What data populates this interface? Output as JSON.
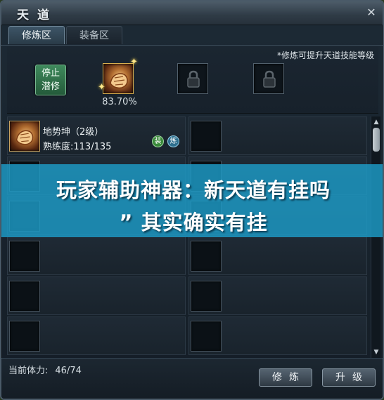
{
  "window": {
    "title": "天道",
    "close_symbol": "✕"
  },
  "tabs": [
    {
      "label": "修炼区",
      "active": true
    },
    {
      "label": "装备区",
      "active": false
    }
  ],
  "top_panel": {
    "hint": "*修炼可提升天道技能等级",
    "stop_button_line1": "停止",
    "stop_button_line2": "潜修",
    "active_skill_icon": "fist-skill-icon",
    "progress": "83.70%",
    "locked_slot_icon": "lock-icon"
  },
  "skills": [
    {
      "name": "地势坤（2级）",
      "proficiency": "熟练度:113/135",
      "equip_badge": "装",
      "train_badge": "炼"
    }
  ],
  "scroll": {
    "up": "▲",
    "down": "▼"
  },
  "bottom": {
    "stamina_label": "当前体力:",
    "stamina_value": "46/74",
    "train_button": "修炼",
    "upgrade_button": "升级"
  },
  "overlay": {
    "line1": "玩家辅助神器：新天道有挂吗",
    "line2": "” 其实确实有挂"
  },
  "colors": {
    "overlay": "#1d9cc8",
    "stop_button": "#3f8a5c"
  }
}
